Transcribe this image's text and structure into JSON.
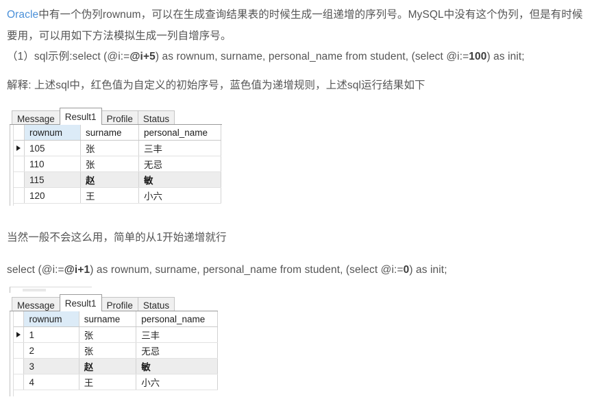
{
  "article": {
    "intro": {
      "link_text": "Oracle",
      "rest": "中有一个伪列rownum，可以在生成查询结果表的时候生成一组递增的序列号。MySQL中没有这个伪列，但是有时候要用，可以用如下方法模拟生成一列自增序号。"
    },
    "sql_example_1": {
      "prefix": "（1）sql示例:select (@i:=",
      "emph_1": "@i+5",
      "middle": ") as rownum, surname, personal_name from student, (select @i:=",
      "emph_2": "100",
      "suffix": ") as init;"
    },
    "explanation": "解释: 上述sql中，红色值为自定义的初始序号，蓝色值为递增规则，上述sql运行结果如下",
    "note": "当然一般不会这么用，简单的从1开始递增就行",
    "sql_example_2": {
      "prefix": "select (@i:=",
      "emph_1": "@i+1",
      "middle": ") as rownum, surname, personal_name from student, (select @i:=",
      "emph_2": "0",
      "suffix": ") as init;"
    }
  },
  "colors": {
    "link": "#4a90d9",
    "text": "#555555",
    "selected_column_header": "#dcebf7",
    "alt_row": "#ededed",
    "tab_inactive": "#f0f0f0",
    "tab_active": "#ffffff"
  },
  "result_panel_1": {
    "tabs": [
      {
        "label": "Message",
        "active": false
      },
      {
        "label": "Result1",
        "active": true
      },
      {
        "label": "Profile",
        "active": false
      },
      {
        "label": "Status",
        "active": false
      }
    ],
    "columns": [
      "rownum",
      "surname",
      "personal_name"
    ],
    "selected_column": "rownum",
    "current_row_index": 0,
    "rows": [
      {
        "rownum": "105",
        "surname": "张",
        "personal_name": "三丰"
      },
      {
        "rownum": "110",
        "surname": "张",
        "personal_name": "无忌"
      },
      {
        "rownum": "115",
        "surname": "赵",
        "personal_name": "敏"
      },
      {
        "rownum": "120",
        "surname": "王",
        "personal_name": "小六"
      }
    ],
    "highlighted_row_index": 2
  },
  "result_panel_2": {
    "tabs": [
      {
        "label": "Message",
        "active": false
      },
      {
        "label": "Result1",
        "active": true
      },
      {
        "label": "Profile",
        "active": false
      },
      {
        "label": "Status",
        "active": false
      }
    ],
    "columns": [
      "rownum",
      "surname",
      "personal_name"
    ],
    "selected_column": "rownum",
    "current_row_index": 0,
    "rows": [
      {
        "rownum": "1",
        "surname": "张",
        "personal_name": "三丰"
      },
      {
        "rownum": "2",
        "surname": "张",
        "personal_name": "无忌"
      },
      {
        "rownum": "3",
        "surname": "赵",
        "personal_name": "敏"
      },
      {
        "rownum": "4",
        "surname": "王",
        "personal_name": "小六"
      }
    ],
    "highlighted_row_index": 2
  }
}
